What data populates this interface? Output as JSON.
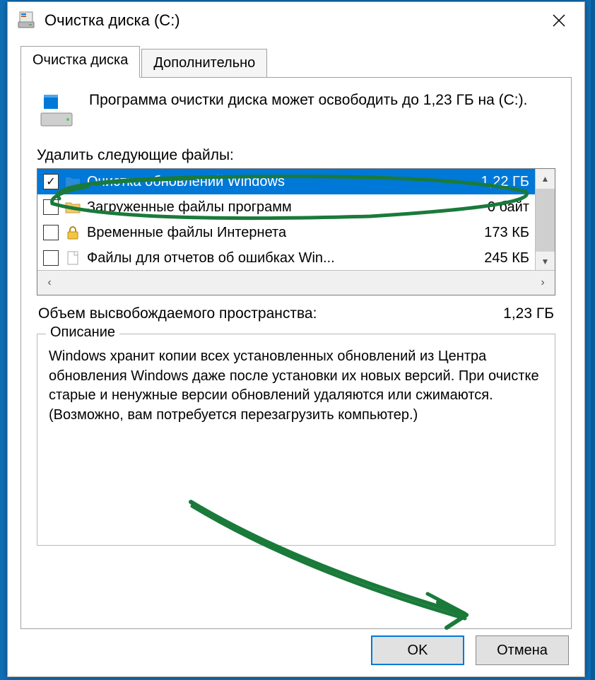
{
  "window": {
    "title": "Очистка диска  (C:)"
  },
  "tabs": {
    "cleanup": "Очистка диска",
    "advanced": "Дополнительно"
  },
  "info": "Программа очистки диска может освободить до 1,23 ГБ на  (C:).",
  "list_label": "Удалить следующие файлы:",
  "items": [
    {
      "name": "Очистка обновлений Windows",
      "size": "1,22 ГБ",
      "checked": true,
      "selected": true,
      "icon": "folder-blue"
    },
    {
      "name": "Загруженные файлы программ",
      "size": "0 байт",
      "checked": false,
      "selected": false,
      "icon": "folder-yellow"
    },
    {
      "name": "Временные файлы Интернета",
      "size": "173 КБ",
      "checked": false,
      "selected": false,
      "icon": "lock"
    },
    {
      "name": "Файлы для отчетов об ошибках Win...",
      "size": "245 КБ",
      "checked": false,
      "selected": false,
      "icon": "page"
    }
  ],
  "summary": {
    "label": "Объем высвобождаемого пространства:",
    "value": "1,23 ГБ"
  },
  "description": {
    "title": "Описание",
    "text": "Windows хранит копии всех установленных обновлений из Центра обновления Windows даже после установки их новых версий. При очистке старые и ненужные версии обновлений удаляются или сжимаются. (Возможно, вам потребуется перезагрузить компьютер.)"
  },
  "buttons": {
    "ok": "OK",
    "cancel": "Отмена"
  },
  "annotation_color": "#1a7a3a"
}
